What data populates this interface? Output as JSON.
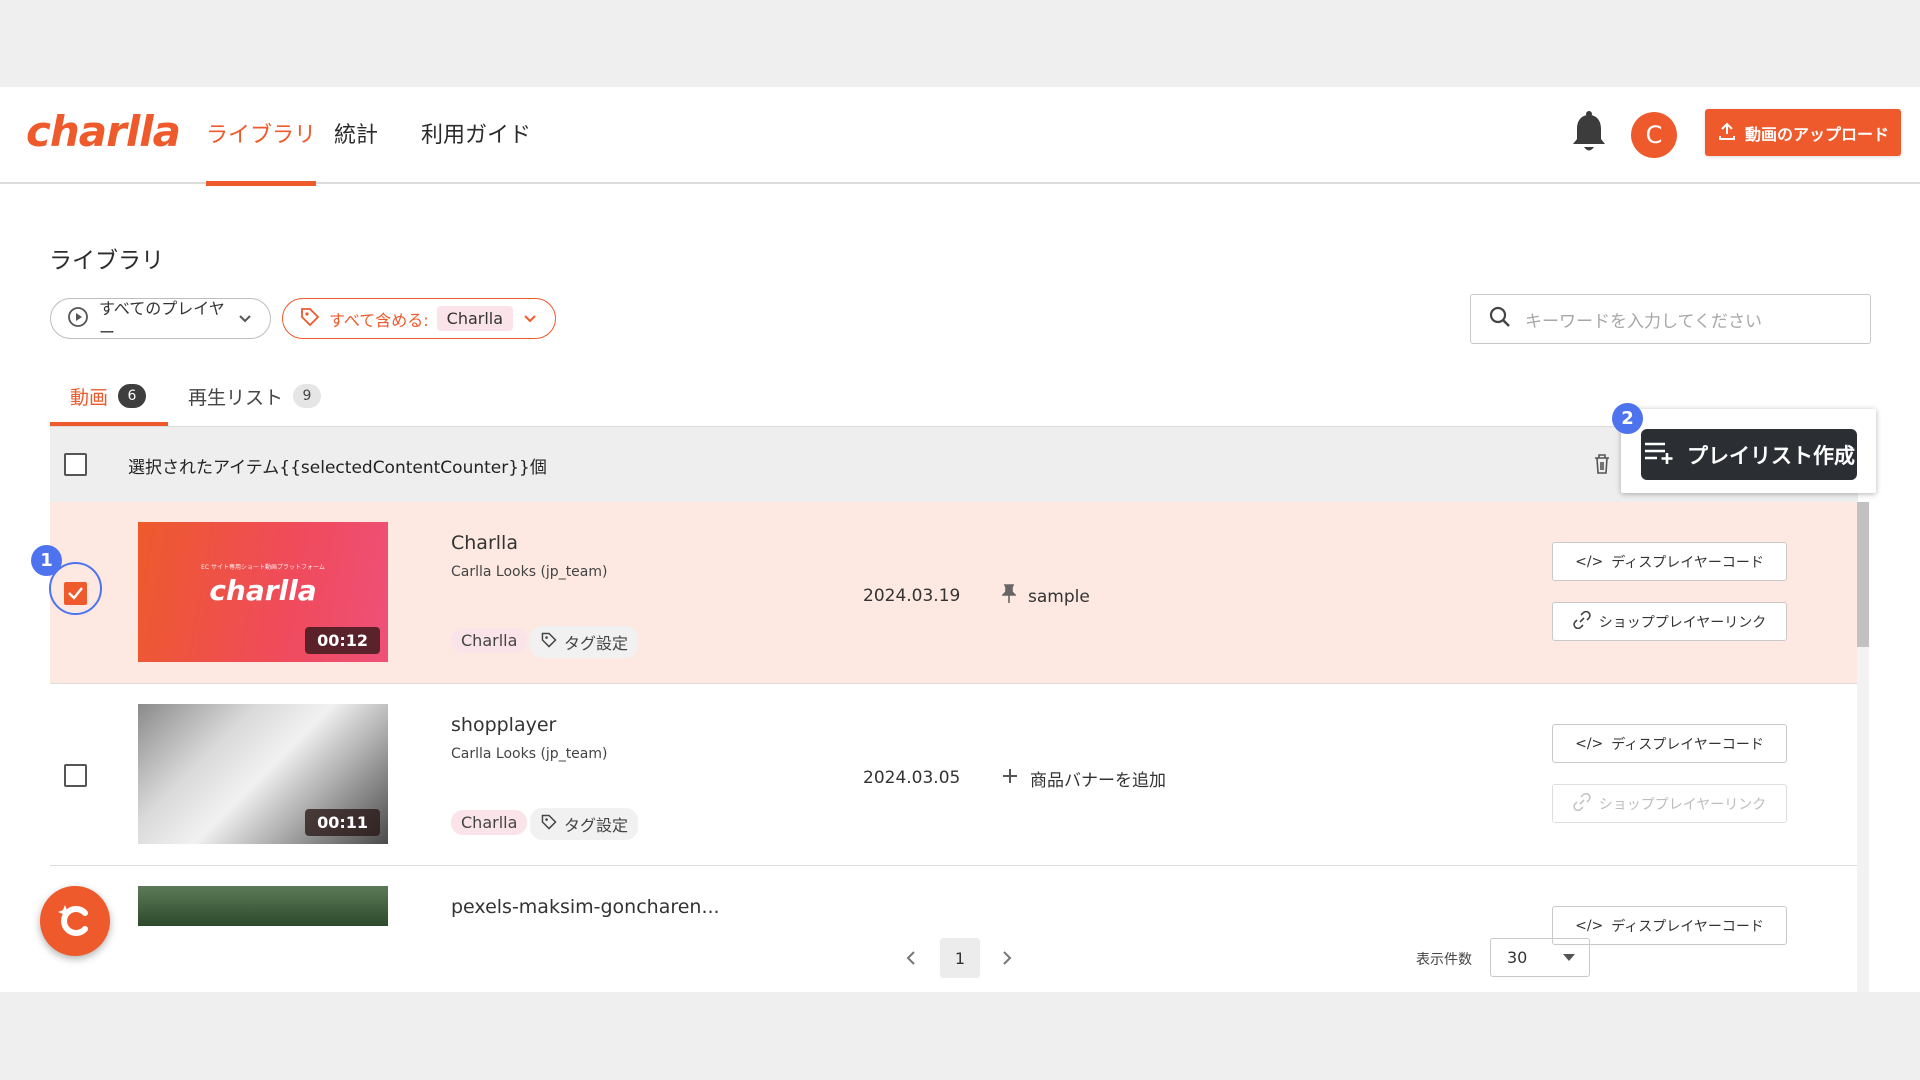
{
  "app": {
    "logo": "charlla",
    "nav": [
      "ライブラリ",
      "統計",
      "利用ガイド"
    ],
    "avatar_initial": "C",
    "upload_label": "動画のアップロード",
    "accent": "#ee5a2c"
  },
  "page": {
    "title": "ライブラリ",
    "filters": {
      "player": "すべてのプレイヤー",
      "tag_prefix": "すべて含める:",
      "tag_value": "Charlla"
    },
    "search_placeholder": "キーワードを入力してください",
    "tabs": [
      {
        "label": "動画",
        "count": "6"
      },
      {
        "label": "再生リスト",
        "count": "9"
      }
    ],
    "selection_text": "選択されたアイテム{{selectedContentCounter}}個",
    "playlist_button": "プレイリスト作成",
    "steps": [
      "1",
      "2"
    ]
  },
  "rows": [
    {
      "title": "Charlla",
      "owner": "Carlla Looks (jp_team)",
      "duration": "00:12",
      "thumb_logo": "charlla",
      "thumb_sub": "EC サイト専用ショート動画プラットフォーム",
      "chip": "Charlla",
      "tag_setting": "タグ設定",
      "date": "2024.03.19",
      "meta": "sample",
      "meta_icon": "pin-icon",
      "code_btn": "ディスプレイヤーコード",
      "link_btn": "ショッププレイヤーリンク",
      "checked": true
    },
    {
      "title": "shopplayer",
      "owner": "Carlla Looks (jp_team)",
      "duration": "00:11",
      "chip": "Charlla",
      "tag_setting": "タグ設定",
      "date": "2024.03.05",
      "meta": "商品バナーを追加",
      "meta_icon": "plus-icon",
      "code_btn": "ディスプレイヤーコード",
      "link_btn": "ショッププレイヤーリンク",
      "checked": false
    },
    {
      "title": "pexels-maksim-goncharen...",
      "code_btn": "ディスプレイヤーコード"
    }
  ],
  "pagination": {
    "page": "1",
    "per_page_label": "表示件数",
    "per_page_value": "30"
  }
}
